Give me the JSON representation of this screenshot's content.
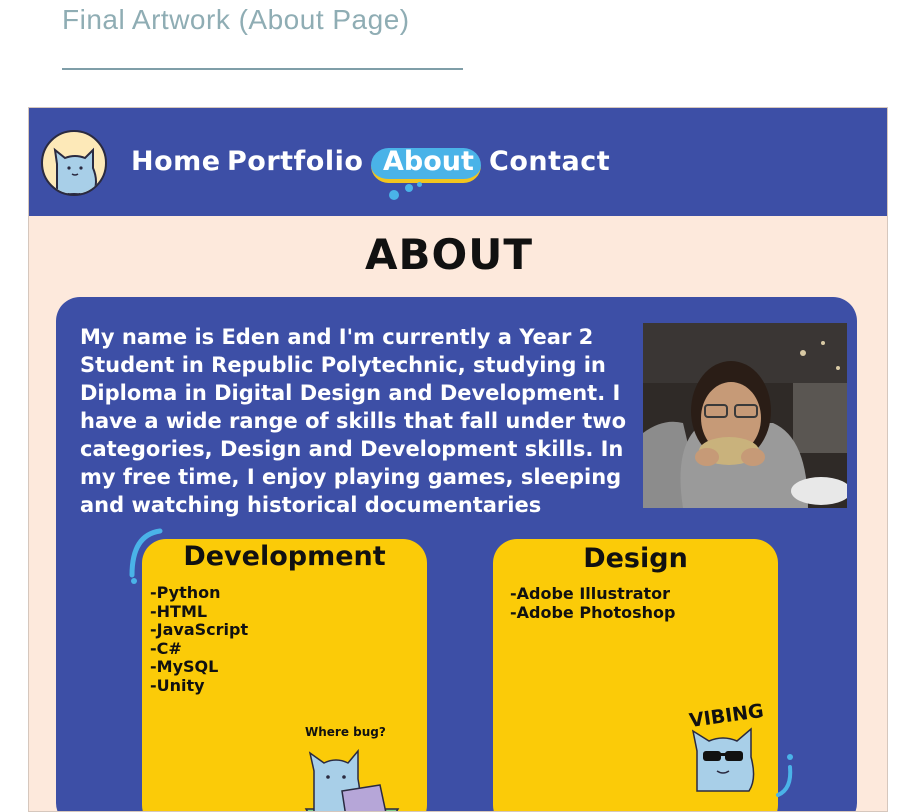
{
  "page": {
    "heading": "Final Artwork (About Page)"
  },
  "nav": {
    "items": [
      {
        "label": "Home"
      },
      {
        "label": "Portfolio"
      },
      {
        "label": "About"
      },
      {
        "label": "Contact"
      }
    ],
    "active": "About"
  },
  "about": {
    "title": "ABOUT",
    "bio": "My name is Eden and I'm currently a Year 2 Student in Republic Polytechnic, studying in Diploma in Digital Design and Development. I have a wide range of skills that fall under two categories, Design and Development skills. In my free time, I enjoy playing games, sleeping and watching historical documentaries"
  },
  "skills": {
    "development": {
      "title": "Development",
      "items": [
        "-Python",
        "-HTML",
        "-JavaScript",
        "-C#",
        "-MySQL",
        "-Unity"
      ],
      "sticker_text": "Where bug?"
    },
    "design": {
      "title": "Design",
      "items": [
        "-Adobe Illustrator",
        "-Adobe Photoshop"
      ],
      "sticker_text": "VIBING"
    }
  },
  "colors": {
    "navbar": "#3d4fa6",
    "background": "#fde9dc",
    "card": "#3d4fa6",
    "skill_card": "#fbcb08",
    "accent": "#4ab3e8"
  },
  "icons": {
    "logo": "cat-logo-icon",
    "dev_sticker": "cat-laptop-sticker",
    "design_sticker": "cat-sunglasses-sticker"
  }
}
